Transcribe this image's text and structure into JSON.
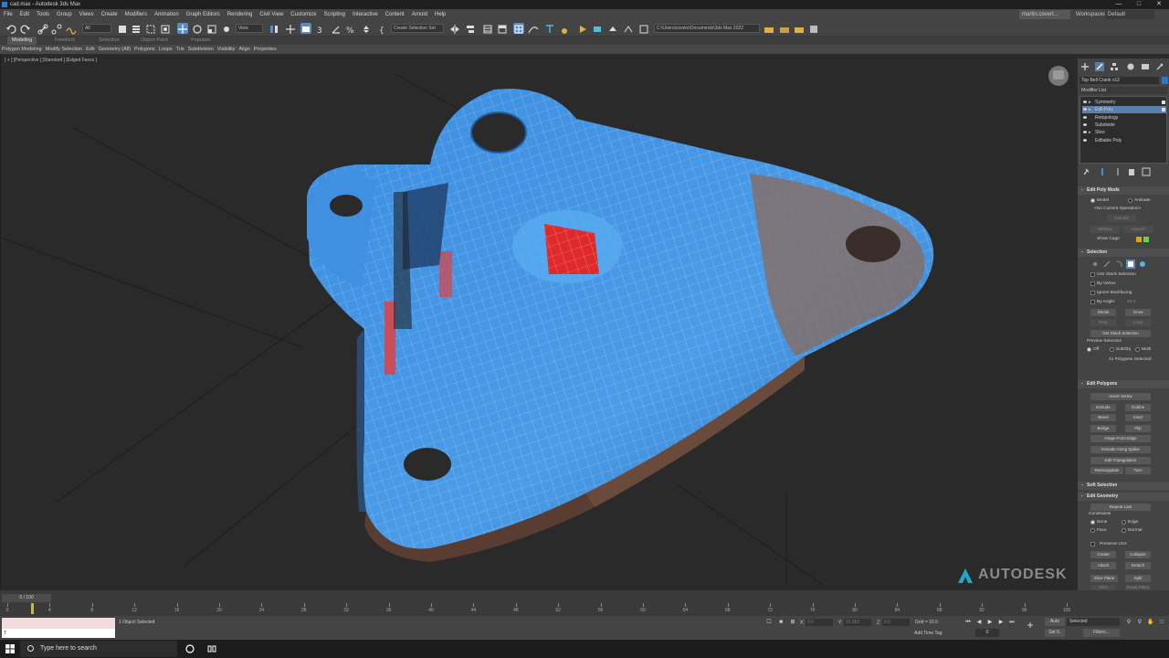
{
  "window": {
    "title": "cad.max - Autodesk 3ds Max"
  },
  "menu": [
    "File",
    "Edit",
    "Tools",
    "Group",
    "Views",
    "Create",
    "Modifiers",
    "Animation",
    "Graph Editors",
    "Rendering",
    "Civil View",
    "Customize",
    "Scripting",
    "Interactive",
    "Content",
    "Arnold",
    "Help"
  ],
  "user": "martin.covert...",
  "workspace": {
    "label": "Workspaces:",
    "value": "Default"
  },
  "toolbar": {
    "filter": "All",
    "refcoord": "View",
    "selset": "Create Selection Set",
    "path": "C:\\Users\\covers\\Documents\\3ds Max 2022"
  },
  "ribbon": {
    "tabs": [
      "Modeling",
      "Freeform",
      "Selection",
      "Object Paint",
      "Populate"
    ],
    "active": "Modeling",
    "sub": [
      "Polygon Modeling",
      "Modify Selection",
      "Edit",
      "Geometry (All)",
      "Polygons",
      "Loops",
      "Tris",
      "Subdivision",
      "Visibility",
      "Align",
      "Properties"
    ]
  },
  "viewport": {
    "label": "[ + ] [Perspective ] [Standard ] [Edged Faces ]",
    "brand": "AUTODESK"
  },
  "command_panel": {
    "object_name": "Top Bell Crank v12",
    "object_color": "#2d76c8",
    "modifier_list": "Modifier List",
    "stack": [
      {
        "name": "Symmetry",
        "selected": false,
        "arrow": true
      },
      {
        "name": "Edit Poly",
        "selected": true,
        "arrow": true
      },
      {
        "name": "Retopology",
        "selected": false,
        "arrow": false
      },
      {
        "name": "Subdivide",
        "selected": false,
        "arrow": false
      },
      {
        "name": "Slice",
        "selected": false,
        "arrow": true
      },
      {
        "name": "Editable Poly",
        "selected": false,
        "arrow": false
      }
    ],
    "edit_poly_mode": {
      "title": "Edit Poly Mode",
      "model": "Model",
      "animate": "Animate",
      "no_op": "<No Current Operation>",
      "commit": "Commit",
      "settings": "Settings",
      "cancel": "Cancel",
      "show_cage": "Show Cage",
      "cage_colors": [
        "#e0a020",
        "#6ad04a"
      ]
    },
    "selection": {
      "title": "Selection",
      "use_stack": "Use Stack Selection",
      "by_vertex": "By Vertex",
      "ignore_backfacing": "Ignore Backfacing",
      "by_angle": "By Angle:",
      "angle_value": "45.0",
      "shrink": "Shrink",
      "grow": "Grow",
      "ring": "Ring",
      "loop": "Loop",
      "get_stack": "Get Stack Selection",
      "preview": "Preview Selection",
      "off": "Off",
      "subobj": "SubObj",
      "multi": "Multi",
      "count": "41 Polygons Selected"
    },
    "edit_polygons": {
      "title": "Edit Polygons",
      "insert_vertex": "Insert Vertex",
      "extrude": "Extrude",
      "outline": "Outline",
      "bevel": "Bevel",
      "inset": "Inset",
      "bridge": "Bridge",
      "flip": "Flip",
      "hinge": "Hinge From Edge",
      "extrude_spline": "Extrude Along Spline",
      "edit_tri": "Edit Triangulation",
      "retriangulate": "Retriangulate",
      "turn": "Turn"
    },
    "soft_selection": {
      "title": "Soft Selection"
    },
    "edit_geometry": {
      "title": "Edit Geometry",
      "repeat_last": "Repeat Last",
      "constraints": "Constraints",
      "none": "None",
      "edge": "Edge",
      "face": "Face",
      "normal": "Normal",
      "preserve_uvs": "Preserve UVs",
      "create": "Create",
      "collapse": "Collapse",
      "attach": "Attach",
      "detach": "Detach",
      "slice_plane": "Slice Plane",
      "split": "Split",
      "slice": "Slice",
      "reset_plane": "Reset Plane"
    }
  },
  "timeline": {
    "frame_display": "0 / 100",
    "ticks": [
      "0",
      "4",
      "8",
      "12",
      "16",
      "20",
      "24",
      "28",
      "32",
      "36",
      "40",
      "44",
      "48",
      "52",
      "56",
      "60",
      "64",
      "68",
      "72",
      "76",
      "80",
      "84",
      "88",
      "92",
      "96",
      "100"
    ]
  },
  "status": {
    "script_hint": "7",
    "selection": "1 Object Selected",
    "x": "X:",
    "x_val": "0.0",
    "y": "Y:",
    "y_val": "15.082",
    "z": "Z:",
    "z_val": "0.0",
    "grid": "Grid = 10.0",
    "add_time_tag": "Add Time Tag",
    "auto": "Auto",
    "selected": "Selected",
    "setk": "Set K.",
    "filters": "Filters...",
    "frame": "0"
  },
  "taskbar": {
    "search": "Type here to search"
  }
}
